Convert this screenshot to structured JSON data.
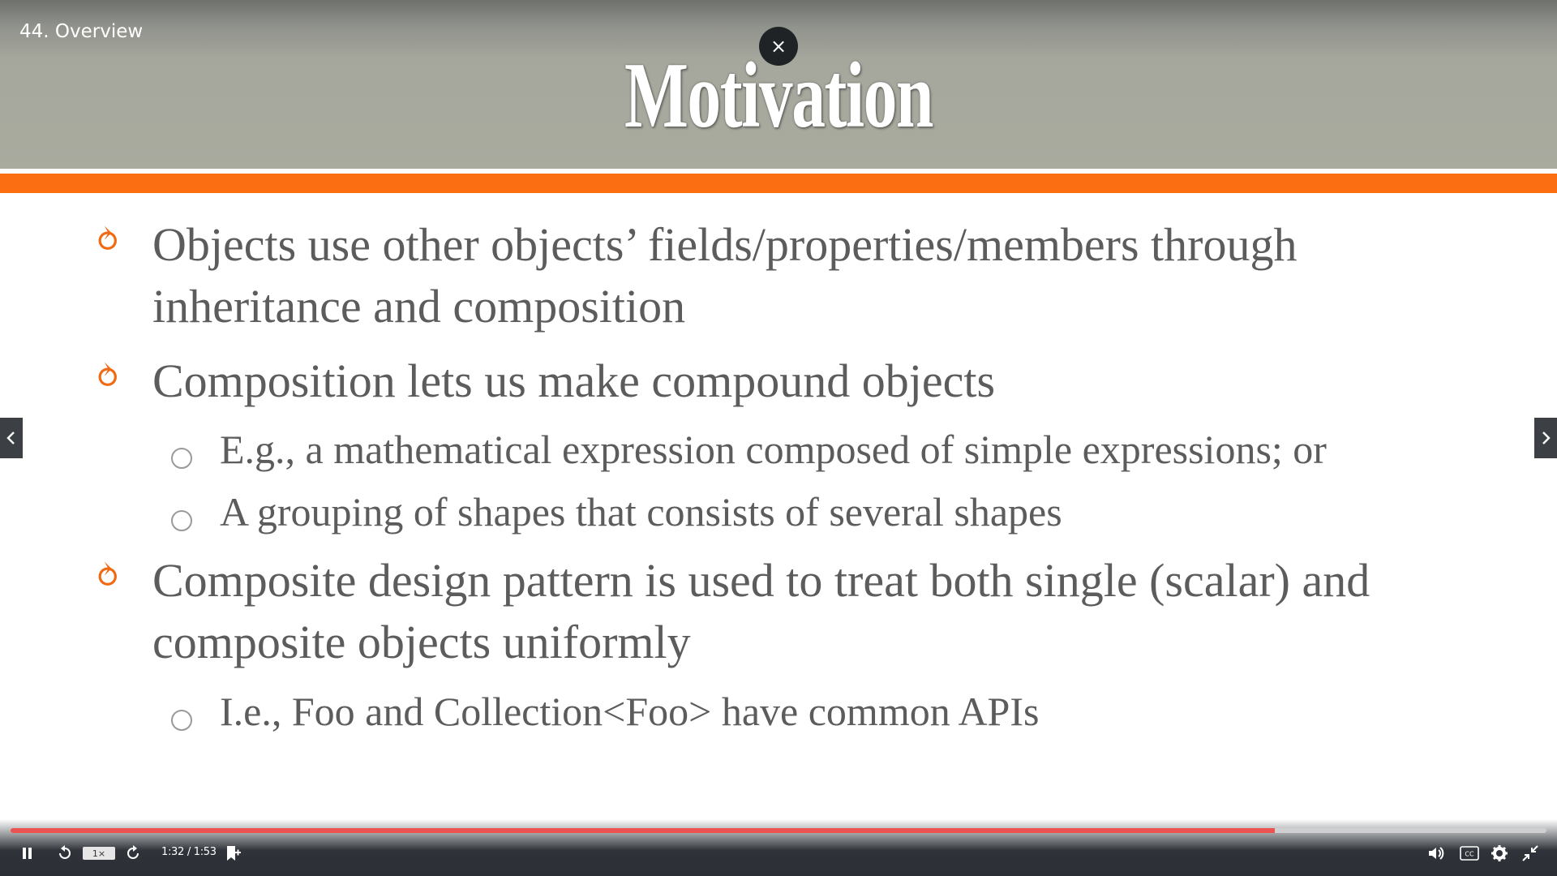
{
  "video": {
    "title": "44. Overview",
    "close_symbol": "×"
  },
  "slide": {
    "title": "Motivation",
    "bullet_symbol": "ƒ",
    "bullets": [
      {
        "text": "Objects use other objects’ fields/properties/members through inheritance and composition",
        "subitems": []
      },
      {
        "text": "Composition lets us make compound objects",
        "subitems": [
          "E.g., a mathematical expression composed of simple expressions; or",
          "A grouping of shapes that consists of several shapes"
        ]
      },
      {
        "text": "Composite design pattern is used to treat both single (scalar) and composite objects uniformly",
        "subitems": [
          "I.e., Foo and Collection<Foo> have common APIs"
        ]
      }
    ]
  },
  "player": {
    "progress": 0.823,
    "speed_label": "1×",
    "time": "1:32 / 1:53",
    "icons": {
      "play_pause": "pause-icon",
      "rewind": "rewind-icon",
      "forward": "forward-icon",
      "bookmark": "add-bookmark-icon",
      "volume": "volume-icon",
      "captions": "captions-icon",
      "settings": "gear-icon",
      "fullscreen": "exit-fullscreen-icon"
    },
    "colors": {
      "progress": "#ec5252",
      "track": "#cfcfd2",
      "accent_bar": "#fb6e12"
    }
  }
}
